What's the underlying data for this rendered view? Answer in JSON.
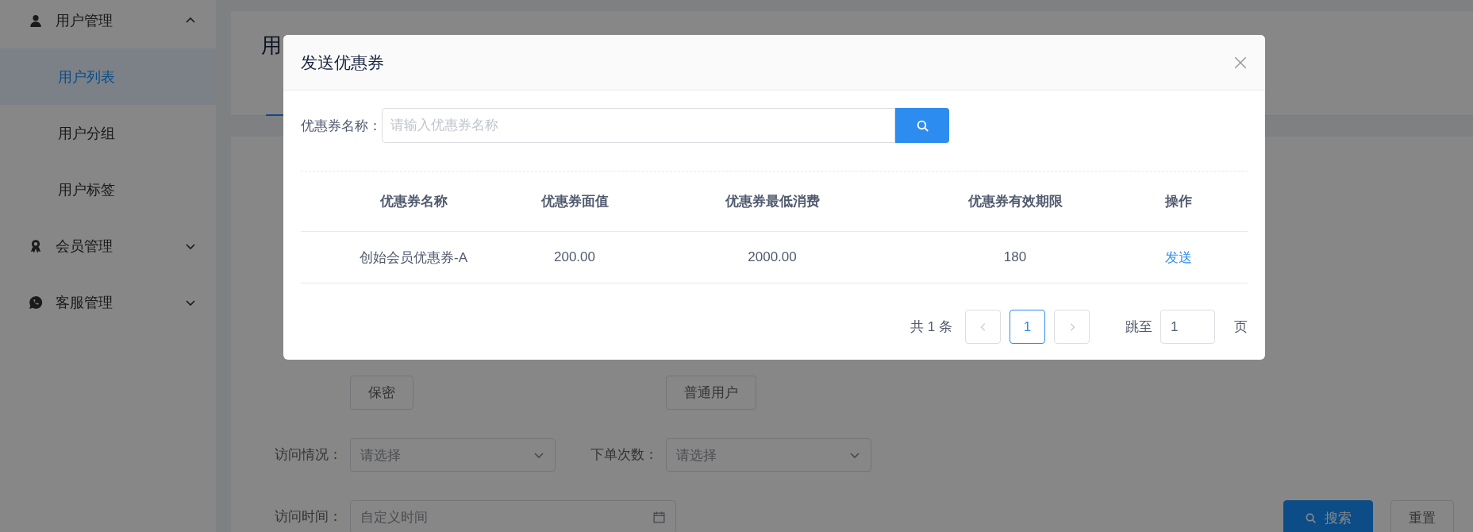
{
  "sidebar": {
    "items": [
      {
        "label": "用户管理",
        "expanded": true,
        "children": [
          {
            "label": "用户列表",
            "selected": true
          },
          {
            "label": "用户分组",
            "selected": false
          },
          {
            "label": "用户标签",
            "selected": false
          }
        ]
      },
      {
        "label": "会员管理",
        "expanded": false
      },
      {
        "label": "客服管理",
        "expanded": false
      }
    ]
  },
  "page": {
    "title": "用",
    "filters": {
      "rows": [
        [
          {
            "kind": "buttons",
            "options": [
              {
                "label": "保密",
                "selected": false
              }
            ]
          },
          {
            "kind": "buttons",
            "options": [
              {
                "label": "普通用户",
                "selected": false
              }
            ]
          }
        ],
        [
          {
            "kind": "select",
            "label": "访问情况：",
            "placeholder": "请选择"
          },
          {
            "kind": "select",
            "label": "下单次数：",
            "placeholder": "请选择"
          }
        ],
        [
          {
            "kind": "date",
            "label": "访问时间：",
            "placeholder": "自定义时间"
          }
        ]
      ],
      "buttons": [
        {
          "kind": "primary",
          "label": "搜索"
        },
        {
          "kind": "default",
          "label": "重置"
        }
      ]
    }
  },
  "modal": {
    "title": "发送优惠券",
    "search": {
      "label": "优惠券名称：",
      "placeholder": "请输入优惠券名称"
    },
    "table": {
      "columns": [
        "优惠券名称",
        "优惠券面值",
        "优惠券最低消费",
        "优惠券有效期限",
        "操作"
      ],
      "rows": [
        {
          "cells": [
            "创始会员优惠券-A",
            "200.00",
            "2000.00",
            "180"
          ],
          "action": "发送"
        }
      ]
    },
    "pagination": {
      "total": "共 1 条",
      "pages": [
        {
          "label": "1",
          "selected": true
        }
      ],
      "jump_label": "跳至",
      "jump_value": "1",
      "suffix": "页"
    }
  }
}
